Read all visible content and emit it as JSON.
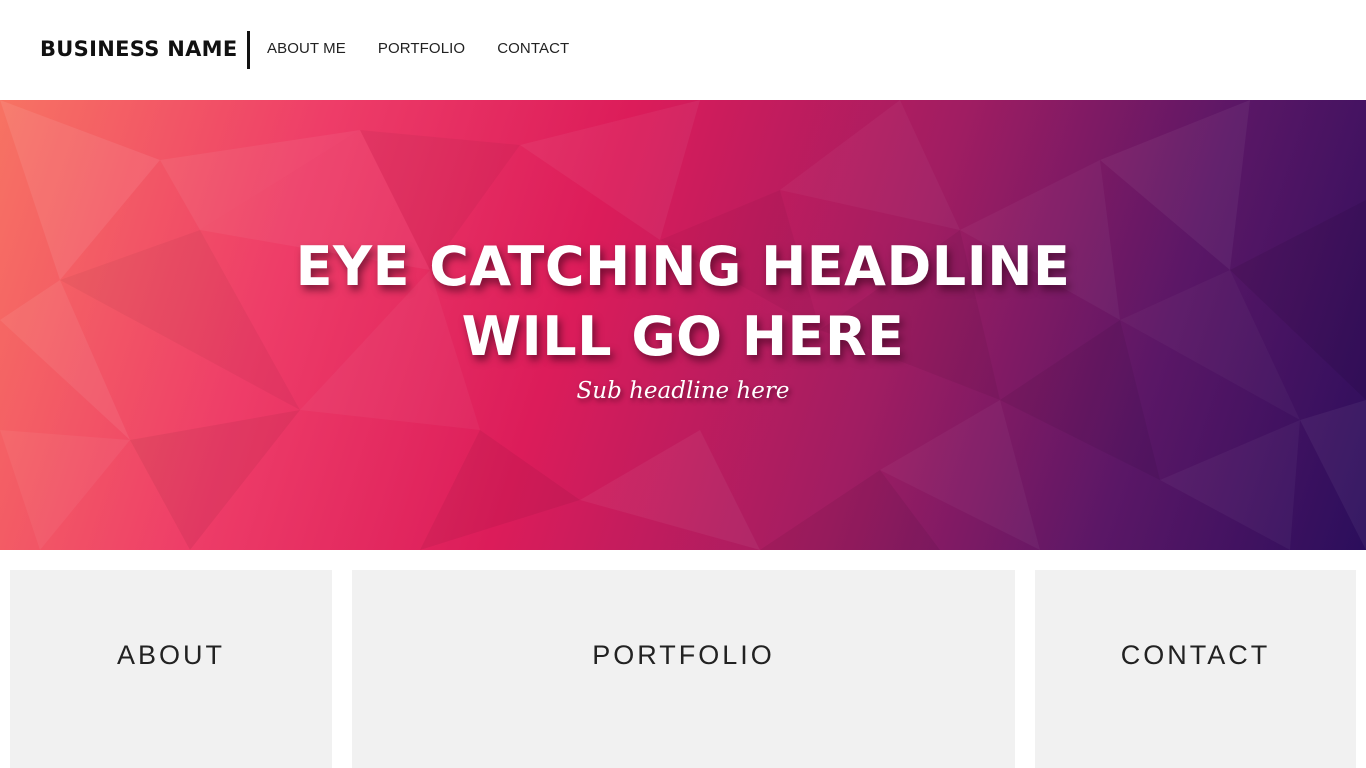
{
  "header": {
    "brand": "BUSINESS NAME",
    "nav": [
      {
        "label": "ABOUT ME"
      },
      {
        "label": "PORTFOLIO"
      },
      {
        "label": "CONTACT"
      }
    ]
  },
  "hero": {
    "headline_line1": "EYE CATCHING HEADLINE",
    "headline_line2": "WILL GO HERE",
    "subheadline": "Sub headline here",
    "gradient_colors": [
      "#f77363",
      "#ee3d68",
      "#dc1c5a",
      "#a01d62",
      "#5b1766",
      "#2b0e5c"
    ]
  },
  "tiles": [
    {
      "label": "ABOUT"
    },
    {
      "label": "PORTFOLIO"
    },
    {
      "label": "CONTACT"
    }
  ],
  "colors": {
    "tile_background": "#f1f1f1",
    "text_dark": "#111111",
    "text_light": "#ffffff"
  }
}
